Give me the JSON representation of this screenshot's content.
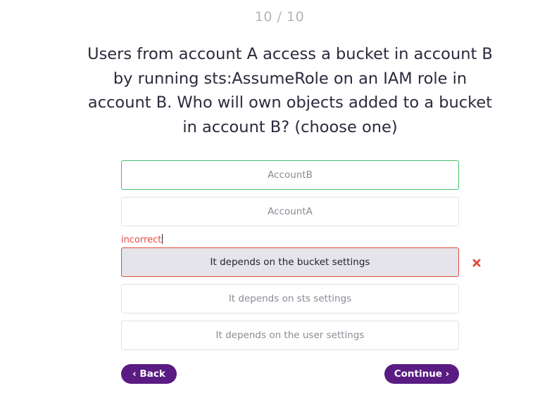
{
  "progress": "10 / 10",
  "question": "Users from account A access a bucket in account B by running sts:AssumeRole on an IAM role in account B. Who will own objects added to a bucket in account B? (choose one)",
  "options": [
    {
      "label": "AccountB",
      "state": "correct"
    },
    {
      "label": "AccountA",
      "state": "default"
    },
    {
      "label": "It depends on the bucket settings",
      "state": "incorrect-selected"
    },
    {
      "label": "It depends on sts settings",
      "state": "default"
    },
    {
      "label": "It depends on the user settings",
      "state": "default"
    }
  ],
  "feedback": {
    "text": "incorrect",
    "icon": "close-icon",
    "color": "#e24a3b"
  },
  "nav": {
    "back_label": "‹ Back",
    "continue_label": "Continue ›"
  },
  "colors": {
    "accent": "#5a1b83",
    "correct": "#3fbf6a",
    "incorrect": "#e24a3b"
  }
}
